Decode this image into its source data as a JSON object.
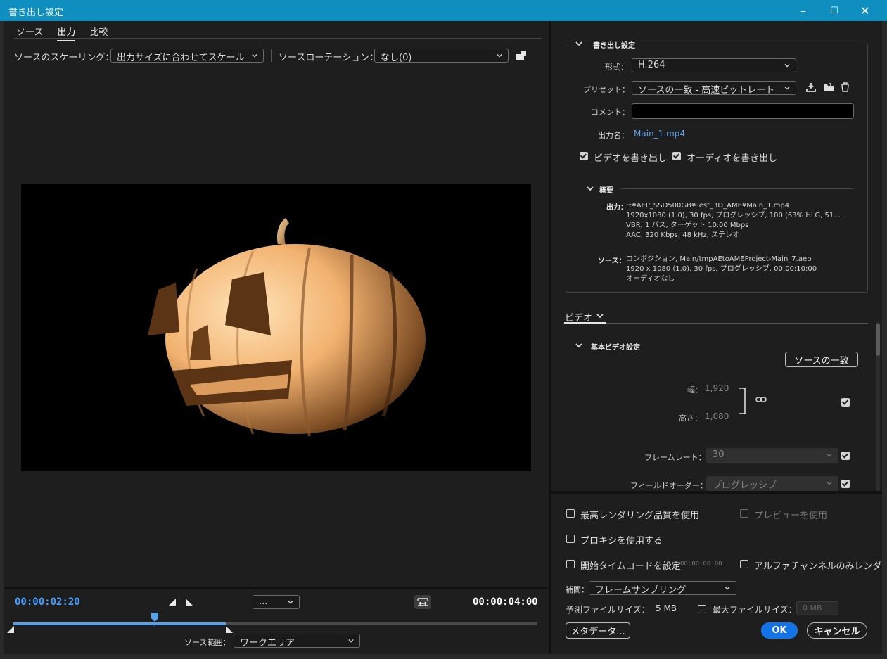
{
  "window": {
    "title": "書き出し設定",
    "minimize": "–",
    "maximize": "☐",
    "close": "✕"
  },
  "tabs": [
    {
      "label": "ソース"
    },
    {
      "label": "出力"
    },
    {
      "label": "比較"
    }
  ],
  "scaling": {
    "label": "ソースのスケーリング：",
    "value": "出力サイズに合わせてスケール"
  },
  "rotation": {
    "label": "ソースローテーション：",
    "value": "なし(0)"
  },
  "timeline": {
    "current": "00:00:02:20",
    "end": "00:00:04:00",
    "zoom": "...",
    "range_label": "ソース範囲：",
    "range_value": "ワークエリア",
    "playhead_fraction": 0.27,
    "work_end_fraction": 0.405
  },
  "export": {
    "section_title": "書き出し設定",
    "format_label": "形式：",
    "format_value": "H.264",
    "preset_label": "プリセット：",
    "preset_value": "ソースの一致 - 高速ビットレート",
    "comment_label": "コメント：",
    "comment_value": "",
    "output_name_label": "出力名：",
    "output_name_value": "Main_1.mp4",
    "export_video_label": "ビデオを書き出し",
    "export_audio_label": "オーディオを書き出し"
  },
  "summary": {
    "title": "概要",
    "output_label": "出力：",
    "output_lines": [
      "F:¥AEP_SSD500GB¥Test_3D_AME¥Main_1.mp4",
      "1920x1080 (1.0), 30 fps, プログレッシブ, 100 (63% HLG, 51...",
      "VBR, 1 パス, ターゲット 10.00 Mbps",
      "AAC, 320 Kbps, 48 kHz, ステレオ"
    ],
    "source_label": "ソース：",
    "source_lines": [
      "コンポジション, Main/tmpAEtoAMEProject-Main_7.aep",
      "1920 x 1080 (1.0), 30 fps, プログレッシブ, 00:00:10:00",
      "オーディオなし"
    ]
  },
  "video": {
    "tab_label": "ビデオ",
    "basic_title": "基本ビデオ設定",
    "match_source": "ソースの一致",
    "width_label": "幅：",
    "width_value": "1,920",
    "height_label": "高さ：",
    "height_value": "1,080",
    "framerate_label": "フレームレート：",
    "framerate_value": "30",
    "field_order_label": "フィールドオーダー：",
    "field_order_value": "プログレッシブ"
  },
  "bottom": {
    "max_render": "最高レンダリング品質を使用",
    "use_preview": "プレビューを使用",
    "use_proxy": "プロキシを使用する",
    "set_timecode": "開始タイムコードを設定",
    "timecode_value": "00:00:00:00",
    "alpha_only": "アルファチャンネルのみレンダリ",
    "interp_label": "補間：",
    "interp_value": "フレームサンプリング",
    "est_size_label": "予測ファイルサイズ：",
    "est_size_value": "5 MB",
    "max_size_label": "最大ファイルサイズ：",
    "max_size_value": "0 MB",
    "metadata": "メタデータ...",
    "ok": "OK",
    "cancel": "キャンセル"
  },
  "colors": {
    "accent": "#1473e6",
    "titlebar": "#0f8fbf",
    "link": "#5aa0e6",
    "pumpkin": "#f2b270"
  }
}
